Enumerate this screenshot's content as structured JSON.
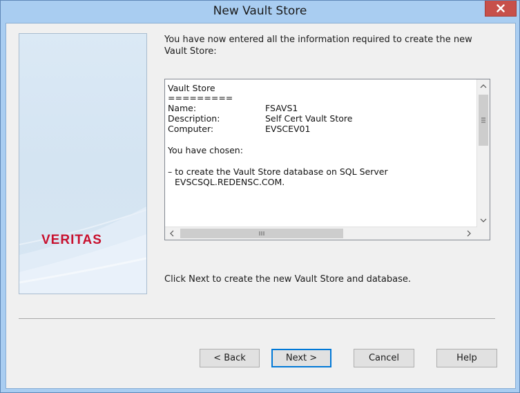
{
  "window": {
    "title": "New Vault Store",
    "close_glyph": "x"
  },
  "side_panel": {
    "logo_text": "VERITAS"
  },
  "intro_text": "You have now entered all the information required to create the new Vault Store:",
  "summary": {
    "heading": "Vault Store",
    "underline": "=========",
    "fields": [
      {
        "label": "Name:",
        "value": "FSAVS1"
      },
      {
        "label": "Description:",
        "value": "Self Cert Vault Store"
      },
      {
        "label": "Computer:",
        "value": "EVSCEV01"
      }
    ],
    "chosen_label": "You have chosen:",
    "choice_line1": "– to create the Vault Store database on SQL Server",
    "choice_line2": "EVSCSQL.REDENSC.COM."
  },
  "scrollbar_icons": {
    "up": "up-arrow-icon",
    "down": "down-arrow-icon",
    "left": "left-arrow-icon",
    "right": "right-arrow-icon"
  },
  "footer_text": "Click Next to create the new Vault Store and database.",
  "buttons": {
    "back": "< Back",
    "next": "Next >",
    "cancel": "Cancel",
    "help": "Help"
  },
  "colors": {
    "titlebar": "#a9cdf1",
    "close_button": "#c7504a",
    "logo": "#c8102e",
    "default_button_border": "#0078d7"
  }
}
